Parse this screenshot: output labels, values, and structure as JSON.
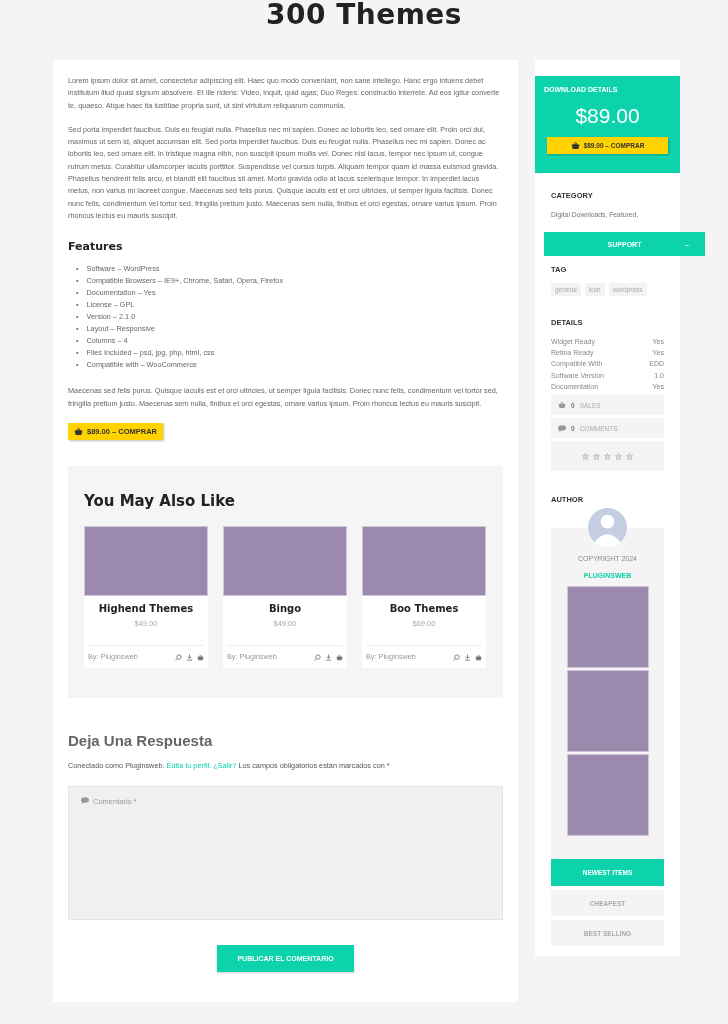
{
  "page_title": "300 Themes",
  "intro_paragraphs": [
    "Lorem ipsum dolor sit amet, consectetur adipiscing elit. Haec quo modo conveniant, non sane intellego. Hanc ergo intuens debet institutum illud quasi signum absolvere. Et ille ridens: Video, inquit, quid agas; Duo Reges: constructio interrete. Ad eos igitur converte te, quaeso. Atque haec ita iustitiae propria sunt, ut sint virtutum reliquarum communia.",
    "Sed porta imperdiet faucibus. Duis eu feugiat nulla. Phasellus nec mi sapien. Donec ac lobortis leo, sed ornare elit. Proin orci dui, maximus ut sem id, aliquet accumsan elit. Sed porta imperdiet faucibus. Duis eu feugiat nulla. Phasellus nec mi sapien. Donec ac lobortis leo, sed ornare elit. In tristique magna nibh, non suscipit ipsum mollis vel. Donec nisl lacus, tempor nec ipsum ut, congue rutrum metus. Curabitur ullamcorper iaculis porttitor. Suspendisse vel cursus turpis. Aliquam tempor quam id massa euismod gravida. Phasellus hendrerit felis arcu, et blandit elit faucibus sit amet. Morbi gravida odio at lacus scelerisque tempor. In imperdiet lacus metus, non varius mi laoreet congue. Maecenas sed felis purus. Quisque iaculis est et orci ultricies, ut semper ligula facilisis. Donec nunc felis, condimentum vel tortor sed, fringilla pretium justo. Maecenas sem nulla, finibus et orci egestas, ornare varius ipsum. Proin rhoncus lectus eu mauris suscipit."
  ],
  "features": {
    "heading": "Features",
    "bullet": "•",
    "items": [
      "Software – WordPress",
      "Compatible Browsers – IE9+, Chrome, Safari, Opera, Firefox",
      "Documentation – Yes",
      "License – GPL",
      "Version – 2.1.0",
      "Layout – Responsive",
      "Columns – 4",
      "Files Included – psd, jpg, php, html, css",
      "Compatible with – WooCommerce"
    ]
  },
  "outro_paragraph": "Maecenas sed felis purus. Quisque iaculis est et orci ultricies, ut semper ligula facilisis. Donec nunc felis, condimentum vel tortor sed, fringilla pretium justo. Maecenas sem nulla, finibus et orci egestas, ornare varius ipsum. Proin rhoncus lectus eu mauris suscipit.",
  "buy_button": "$89.00 – COMPRAR",
  "related": {
    "heading": "You May Also Like",
    "items": [
      {
        "title": "Highend Themes",
        "price": "$49.00",
        "author": "By: Pluginsweb"
      },
      {
        "title": "Bingo",
        "price": "$49.00",
        "author": "By: Pluginsweb"
      },
      {
        "title": "Boo Themes",
        "price": "$69.00",
        "author": "By: Pluginsweb"
      }
    ]
  },
  "reply": {
    "heading": "Deja Una Respuesta",
    "logged_in": "Conectado como Pluginsweb.",
    "profile_link": "Edita tu perfil.",
    "logout_link": "¿Salir?",
    "required_note": "Los campos obligatorios están marcados con *",
    "comment_placeholder": "Comentario *",
    "submit": "PUBLICAR EL COMENTARIO"
  },
  "sidebar": {
    "download": {
      "heading": "DOWNLOAD DETAILS",
      "price": "$89.00",
      "button": "$89.00 – COMPRAR"
    },
    "category": {
      "heading": "CATEGORY",
      "text": "Digital Downloads, Featured,"
    },
    "support": {
      "label": "SUPPORT",
      "toggle": "–"
    },
    "tag": {
      "heading": "TAG",
      "tags": [
        "general",
        "icon",
        "wordpress"
      ]
    },
    "details": {
      "heading": "DETAILS",
      "rows": [
        {
          "label": "Widget Ready",
          "value": "Yes"
        },
        {
          "label": "Retina Ready",
          "value": "Yes"
        },
        {
          "label": "Compatible With",
          "value": "EDD"
        },
        {
          "label": "Software Version",
          "value": "1.0"
        },
        {
          "label": "Documentation",
          "value": "Yes"
        }
      ]
    },
    "stats": [
      {
        "kind": "sales",
        "count": "0",
        "label": "SALES"
      },
      {
        "kind": "comments",
        "count": "0",
        "label": "COMMENTS"
      }
    ],
    "rating": {
      "stars": 0
    },
    "author": {
      "heading": "AUTHOR",
      "copyright": "COPYRIGHT 2024",
      "name": "PLUGINSWEB"
    },
    "sort_tabs": [
      {
        "label": "NEWEST ITEMS",
        "selected": true
      },
      {
        "label": "CHEAPEST",
        "selected": false
      },
      {
        "label": "BEST SELLING",
        "selected": false
      }
    ]
  }
}
